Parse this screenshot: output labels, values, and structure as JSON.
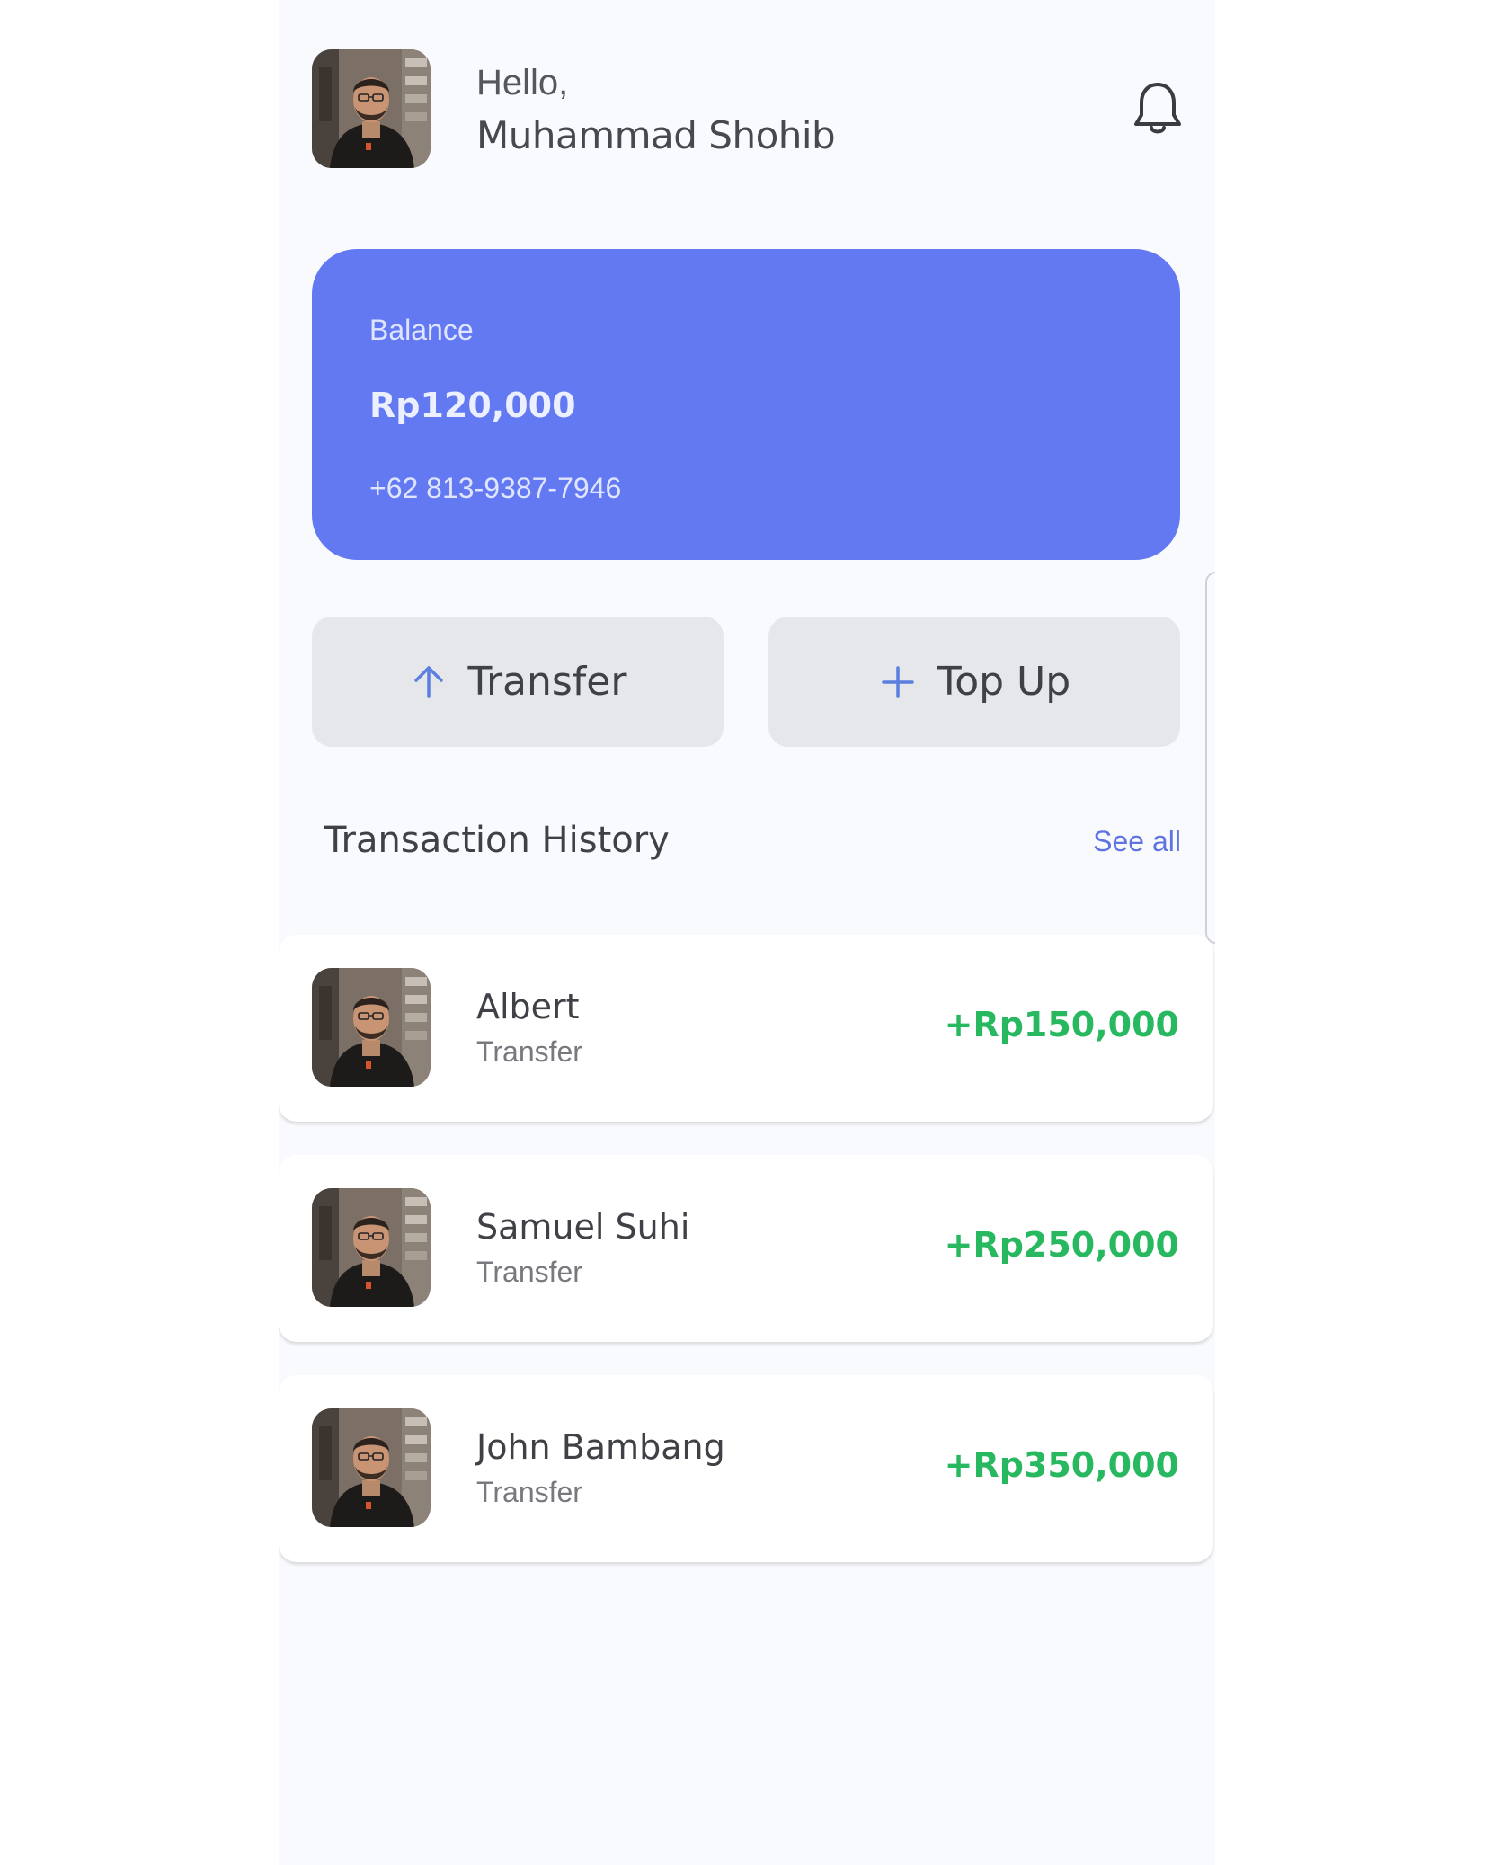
{
  "header": {
    "greeting": "Hello,",
    "user_name": "Muhammad Shohib",
    "avatar_icon": "user-photo",
    "notification_icon": "bell-icon"
  },
  "balance_card": {
    "label": "Balance",
    "amount": "Rp120,000",
    "phone": "+62 813-9387-7946",
    "color": "#6379f2"
  },
  "actions": {
    "transfer_label": "Transfer",
    "transfer_icon": "arrow-up-icon",
    "topup_label": "Top Up",
    "topup_icon": "plus-icon"
  },
  "history": {
    "title": "Transaction History",
    "see_all": "See all",
    "items": [
      {
        "name": "Albert",
        "type": "Transfer",
        "amount": "+Rp150,000"
      },
      {
        "name": "Samuel Suhi",
        "type": "Transfer",
        "amount": "+Rp250,000"
      },
      {
        "name": "John Bambang",
        "type": "Transfer",
        "amount": "+Rp350,000"
      }
    ]
  },
  "colors": {
    "accent": "#6379f2",
    "link": "#5f74e0",
    "positive": "#28b85f",
    "button_bg": "#e5e7eb"
  }
}
